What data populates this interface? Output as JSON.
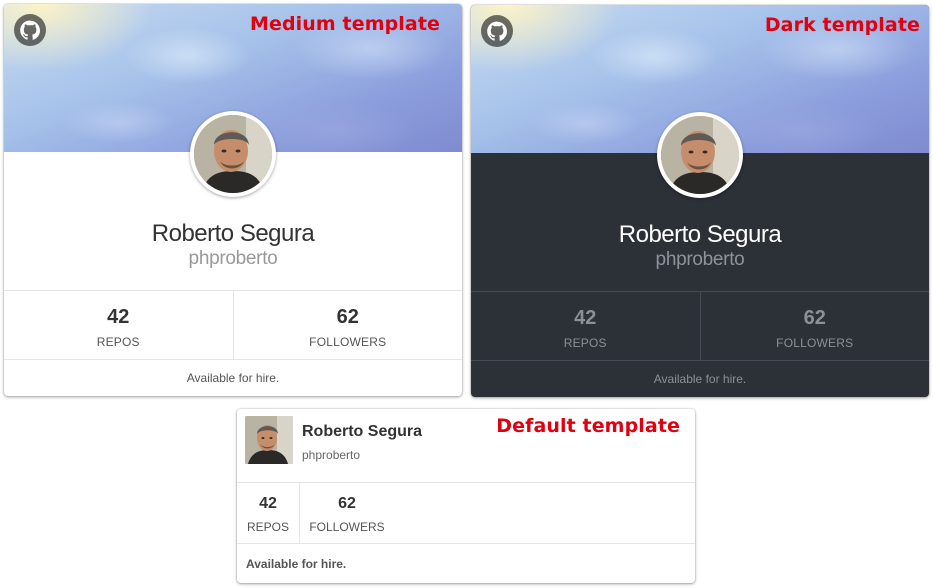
{
  "medium": {
    "template_label": "Medium template",
    "name": "Roberto Segura",
    "username": "phproberto",
    "repos_count": "42",
    "repos_label": "REPOS",
    "followers_count": "62",
    "followers_label": "FOLLOWERS",
    "hire_text": "Available for hire."
  },
  "dark": {
    "template_label": "Dark template",
    "name": "Roberto Segura",
    "username": "phproberto",
    "repos_count": "42",
    "repos_label": "REPOS",
    "followers_count": "62",
    "followers_label": "FOLLOWERS",
    "hire_text": "Available for hire."
  },
  "default": {
    "template_label": "Default template",
    "name": "Roberto Segura",
    "username": "phproberto",
    "repos_count": "42",
    "repos_label": "REPOS",
    "followers_count": "62",
    "followers_label": "FOLLOWERS",
    "hire_text": "Available for hire."
  },
  "icons": {
    "github": "github-octocat-icon"
  },
  "colors": {
    "label_red": "#e0000f",
    "dark_body": "#2c3037",
    "banner_blue": "#8b9ddc"
  }
}
